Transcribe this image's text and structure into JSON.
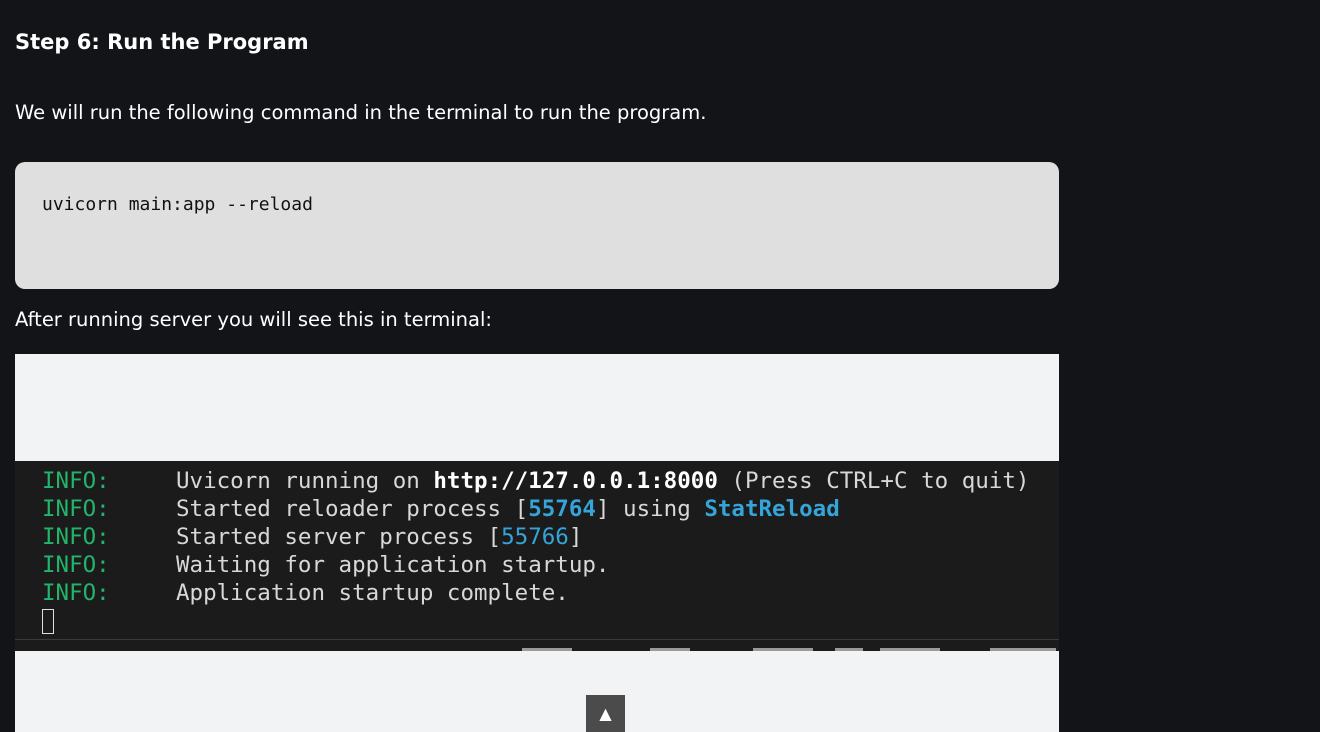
{
  "article": {
    "step_title": "Step 6: Run the Program",
    "intro_text": "We will run the following command in the terminal to run the program.",
    "code": "uvicorn main:app --reload",
    "after_text": "After running server you will see this in terminal:"
  },
  "terminal": {
    "lines": [
      {
        "level": "INFO:",
        "parts": [
          {
            "text": "Uvicorn running on ",
            "style": "normal"
          },
          {
            "text": "http://127.0.0.1:8000",
            "style": "bold"
          },
          {
            "text": " (Press CTRL+C to quit)",
            "style": "normal"
          }
        ]
      },
      {
        "level": "INFO:",
        "parts": [
          {
            "text": "Started reloader process [",
            "style": "normal"
          },
          {
            "text": "55764",
            "style": "num-bold"
          },
          {
            "text": "] using ",
            "style": "normal"
          },
          {
            "text": "StatReload",
            "style": "num-bold"
          }
        ]
      },
      {
        "level": "INFO:",
        "parts": [
          {
            "text": "Started server process [",
            "style": "normal"
          },
          {
            "text": "55766",
            "style": "num"
          },
          {
            "text": "]",
            "style": "normal"
          }
        ]
      },
      {
        "level": "INFO:",
        "parts": [
          {
            "text": "Waiting for application startup.",
            "style": "normal"
          }
        ]
      },
      {
        "level": "INFO:",
        "parts": [
          {
            "text": "Application startup complete.",
            "style": "normal"
          }
        ]
      }
    ]
  },
  "scroll_top": {
    "label": "▲"
  },
  "colors": {
    "page_bg": "#131417",
    "code_bg": "#dfdfdf",
    "terminal_bg": "#1b1b1b",
    "info_green": "#23b46b",
    "highlight_blue": "#35a4d8"
  }
}
